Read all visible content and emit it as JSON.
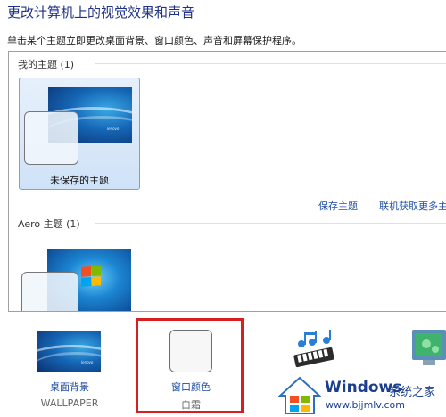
{
  "page": {
    "title": "更改计算机上的视觉效果和声音",
    "subtitle": "单击某个主题立即更改桌面背景、窗口颜色、声音和屏幕保护程序。"
  },
  "themes": {
    "my_themes_header": "我的主题 (1)",
    "unsaved_theme_label": "未保存的主题",
    "wallpaper_brand": "lenovo",
    "save_theme_link": "保存主题",
    "online_themes_link": "联机获取更多主题",
    "aero_header": "Aero 主题 (1)"
  },
  "bottom_bar": {
    "desktop_background": {
      "label": "桌面背景",
      "value": "WALLPAPER"
    },
    "window_color": {
      "label": "窗口颜色",
      "value": "白霜"
    }
  },
  "watermark": {
    "title": "Windows",
    "suffix": "系统之家",
    "url": "www.bjjmlv.com"
  },
  "colors": {
    "title_blue": "#1e3287",
    "link_blue": "#1f4ea3",
    "highlight_red": "#d42020",
    "selection_border": "#7da2ce"
  }
}
